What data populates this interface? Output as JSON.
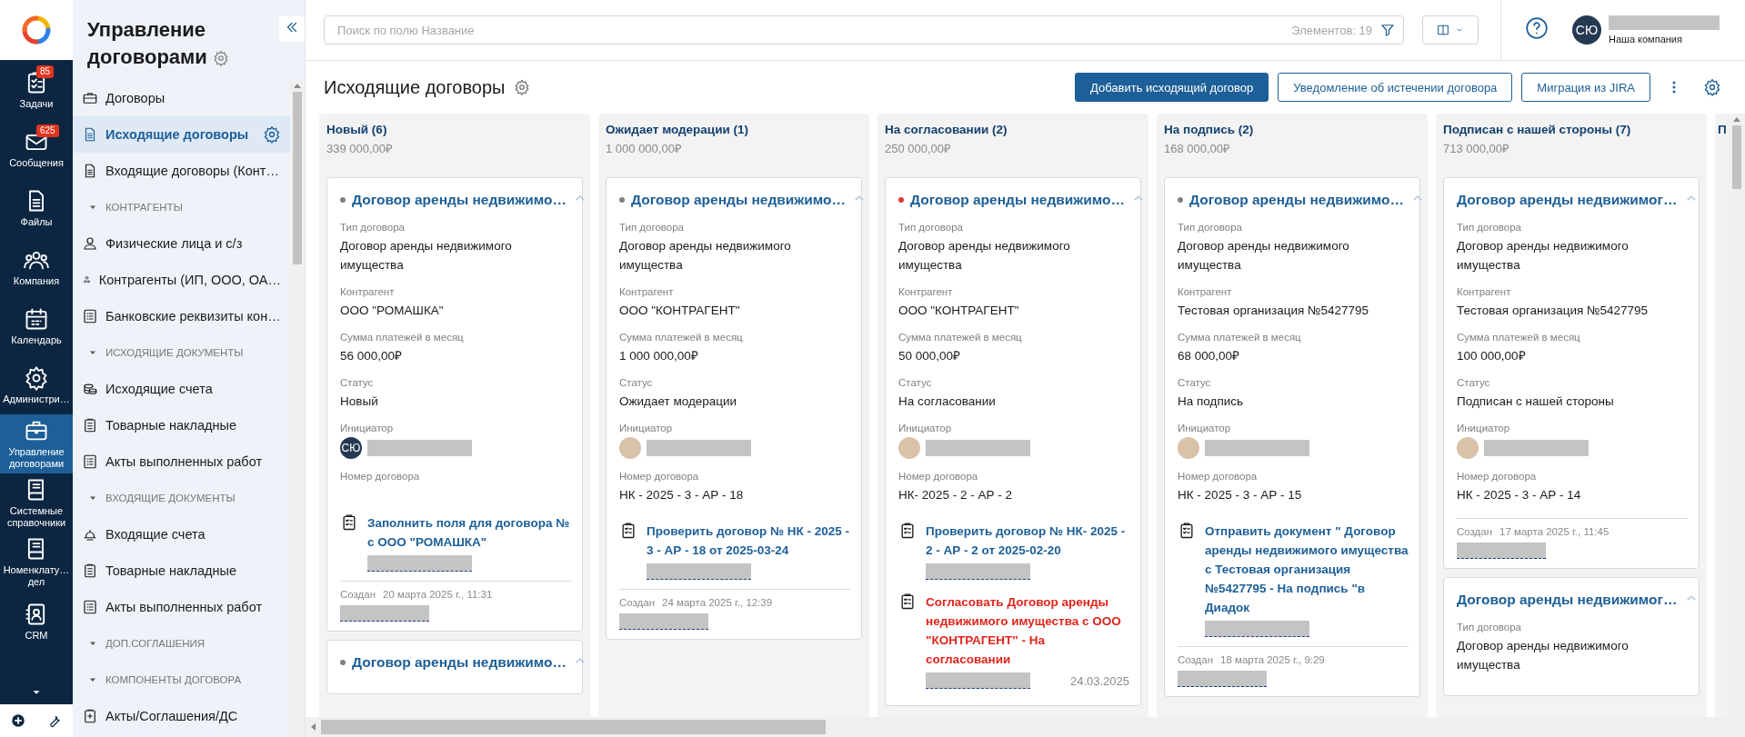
{
  "rail": {
    "items": [
      {
        "label": "Задачи",
        "badge": "85",
        "selected": false
      },
      {
        "label": "Сообщения",
        "badge": "625",
        "selected": false
      },
      {
        "label": "Файлы",
        "selected": false
      },
      {
        "label": "Компания",
        "selected": false
      },
      {
        "label": "Календарь",
        "selected": false
      },
      {
        "label": "Администри…",
        "selected": false
      },
      {
        "label": "Управление договорами",
        "selected": true
      },
      {
        "label": "Системные справочники",
        "selected": false
      },
      {
        "label": "Номенклату… дел",
        "selected": false
      },
      {
        "label": "CRM",
        "selected": false
      }
    ]
  },
  "sidebar": {
    "title": "Управление договорами",
    "items": [
      {
        "kind": "link",
        "label": "Договоры",
        "selected": false
      },
      {
        "kind": "link",
        "label": "Исходящие договоры",
        "selected": true
      },
      {
        "kind": "link",
        "label": "Входящие договоры (Конт…",
        "selected": false
      },
      {
        "kind": "section",
        "label": "КОНТРАГЕНТЫ"
      },
      {
        "kind": "link",
        "label": "Физические лица и с/з",
        "selected": false
      },
      {
        "kind": "link",
        "label": "Контрагенты (ИП, ООО, ОА…",
        "selected": false
      },
      {
        "kind": "link",
        "label": "Банковские реквизиты кон…",
        "selected": false
      },
      {
        "kind": "section",
        "label": "ИСХОДЯЩИЕ ДОКУМЕНТЫ"
      },
      {
        "kind": "link",
        "label": "Исходящие счета",
        "selected": false
      },
      {
        "kind": "link",
        "label": "Товарные накладные",
        "selected": false
      },
      {
        "kind": "link",
        "label": "Акты выполненных работ",
        "selected": false
      },
      {
        "kind": "section",
        "label": "ВХОДЯЩИЕ ДОКУМЕНТЫ"
      },
      {
        "kind": "link",
        "label": "Входящие счета",
        "selected": false
      },
      {
        "kind": "link",
        "label": "Товарные накладные",
        "selected": false
      },
      {
        "kind": "link",
        "label": "Акты выполненных работ",
        "selected": false
      },
      {
        "kind": "section",
        "label": "ДОП.СОГЛАШЕНИЯ"
      },
      {
        "kind": "section",
        "label": "КОМПОНЕНТЫ ДОГОВОРА"
      },
      {
        "kind": "link",
        "label": "Акты/Соглашения/ДС",
        "selected": false
      }
    ]
  },
  "search": {
    "placeholder": "Поиск по полю Название",
    "count": "Элементов: 19"
  },
  "user": {
    "initials": "СЮ",
    "company": "Наша компания"
  },
  "page": {
    "title": "Исходящие договоры",
    "buttons": [
      {
        "label": "Добавить исходящий договор",
        "primary": true
      },
      {
        "label": "Уведомление об истечении договора",
        "primary": false
      },
      {
        "label": "Миграция из JIRA",
        "primary": false
      }
    ]
  },
  "columns": [
    {
      "title": "Новый (6)",
      "sum": "339 000,00₽",
      "cards": [
        {
          "title": "Договор аренды недвижимо…",
          "color": "#808080",
          "fields": [
            {
              "kind": "text",
              "label": "Тип договора",
              "value": "Договор аренды недвижимого имущества"
            },
            {
              "kind": "text",
              "label": "Контрагент",
              "value": "ООО \"РОМАШКА\""
            },
            {
              "kind": "text",
              "label": "Сумма платежей в месяц",
              "value": "56 000,00₽"
            },
            {
              "kind": "text",
              "label": "Статус",
              "value": "Новый"
            },
            {
              "kind": "person",
              "label": "Инициатор",
              "initials": "СЮ"
            },
            {
              "kind": "text",
              "label": "Номер договора"
            }
          ],
          "tasks": [
            {
              "text": "Заполнить поля для договора № с ООО \"РОМАШКА\"",
              "overdue": false
            }
          ],
          "created": {
            "label": "Создан",
            "date": "20 марта 2025 г., 11:31"
          }
        },
        {
          "title": "Договор аренды недвижимо…",
          "color": "#808080"
        }
      ]
    },
    {
      "title": "Ожидает модерации (1)",
      "sum": "1 000 000,00₽",
      "cards": [
        {
          "title": "Договор аренды недвижимо…",
          "color": "#808080",
          "fields": [
            {
              "kind": "text",
              "label": "Тип договора",
              "value": "Договор аренды недвижимого имущества"
            },
            {
              "kind": "text",
              "label": "Контрагент",
              "value": "ООО \"КОНТРАГЕНТ\""
            },
            {
              "kind": "text",
              "label": "Сумма платежей в месяц",
              "value": "1 000 000,00₽"
            },
            {
              "kind": "text",
              "label": "Статус",
              "value": "Ожидает модерации"
            },
            {
              "kind": "person",
              "label": "Инициатор"
            },
            {
              "kind": "text",
              "label": "Номер договора",
              "value": "НК - 2025 - 3 - АР - 18"
            }
          ],
          "tasks": [
            {
              "text": "Проверить договор № НК - 2025 - 3 - АР - 18 от 2025-03-24",
              "overdue": false
            }
          ],
          "created": {
            "label": "Создан",
            "date": "24 марта 2025 г., 12:39"
          }
        }
      ]
    },
    {
      "title": "На согласовании (2)",
      "sum": "250 000,00₽",
      "cards": [
        {
          "title": "Договор аренды недвижимо…",
          "color": "#e53935",
          "fields": [
            {
              "kind": "text",
              "label": "Тип договора",
              "value": "Договор аренды недвижимого имущества"
            },
            {
              "kind": "text",
              "label": "Контрагент",
              "value": "ООО \"КОНТРАГЕНТ\""
            },
            {
              "kind": "text",
              "label": "Сумма платежей в месяц",
              "value": "50 000,00₽"
            },
            {
              "kind": "text",
              "label": "Статус",
              "value": "На согласовании"
            },
            {
              "kind": "person",
              "label": "Инициатор"
            },
            {
              "kind": "text",
              "label": "Номер договора",
              "value": "НК- 2025 - 2 - АР - 2"
            }
          ],
          "tasks": [
            {
              "text": "Проверить договор № НК- 2025 - 2 - АР - 2 от 2025-02-20",
              "overdue": false
            },
            {
              "text": "Согласовать Договор аренды недвижимого имущества с ООО \"КОНТРАГЕНТ\" - На согласовании",
              "overdue": true,
              "date": "24.03.2025"
            }
          ]
        }
      ]
    },
    {
      "title": "На подпись (2)",
      "sum": "168 000,00₽",
      "cards": [
        {
          "title": "Договор аренды недвижимо…",
          "color": "#808080",
          "fields": [
            {
              "kind": "text",
              "label": "Тип договора",
              "value": "Договор аренды недвижимого имущества"
            },
            {
              "kind": "text",
              "label": "Контрагент",
              "value": "Тестовая организация №5427795"
            },
            {
              "kind": "text",
              "label": "Сумма платежей в месяц",
              "value": "68 000,00₽"
            },
            {
              "kind": "text",
              "label": "Статус",
              "value": "На подпись"
            },
            {
              "kind": "person",
              "label": "Инициатор"
            },
            {
              "kind": "text",
              "label": "Номер договора",
              "value": "НК - 2025 - 3 - АР - 15"
            }
          ],
          "tasks": [
            {
              "text": "Отправить документ \" Договор аренды недвижимого имущества с Тестовая организация №5427795 - На подпись \"в Диадок",
              "overdue": false
            }
          ],
          "created": {
            "label": "Создан",
            "date": "18 марта 2025 г., 9:29"
          }
        }
      ]
    },
    {
      "title": "Подписан с нашей стороны (7)",
      "sum": "713 000,00₽",
      "cards": [
        {
          "title": "Договор аренды недвижимог…",
          "fields": [
            {
              "kind": "text",
              "label": "Тип договора",
              "value": "Договор аренды недвижимого имущества"
            },
            {
              "kind": "text",
              "label": "Контрагент",
              "value": "Тестовая организация №5427795"
            },
            {
              "kind": "text",
              "label": "Сумма платежей в месяц",
              "value": "100 000,00₽"
            },
            {
              "kind": "text",
              "label": "Статус",
              "value": "Подписан с нашей стороны"
            },
            {
              "kind": "person",
              "label": "Инициатор"
            },
            {
              "kind": "text",
              "label": "Номер договора",
              "value": "НК - 2025 - 3 - АР - 14"
            }
          ],
          "created": {
            "label": "Создан",
            "date": "17 марта 2025 г., 11:45"
          }
        },
        {
          "title": "Договор аренды недвижимог…",
          "fields": [
            {
              "kind": "text",
              "label": "Тип договора",
              "value": "Договор аренды недвижимого имущества"
            }
          ]
        }
      ]
    },
    {
      "title": "П"
    }
  ]
}
